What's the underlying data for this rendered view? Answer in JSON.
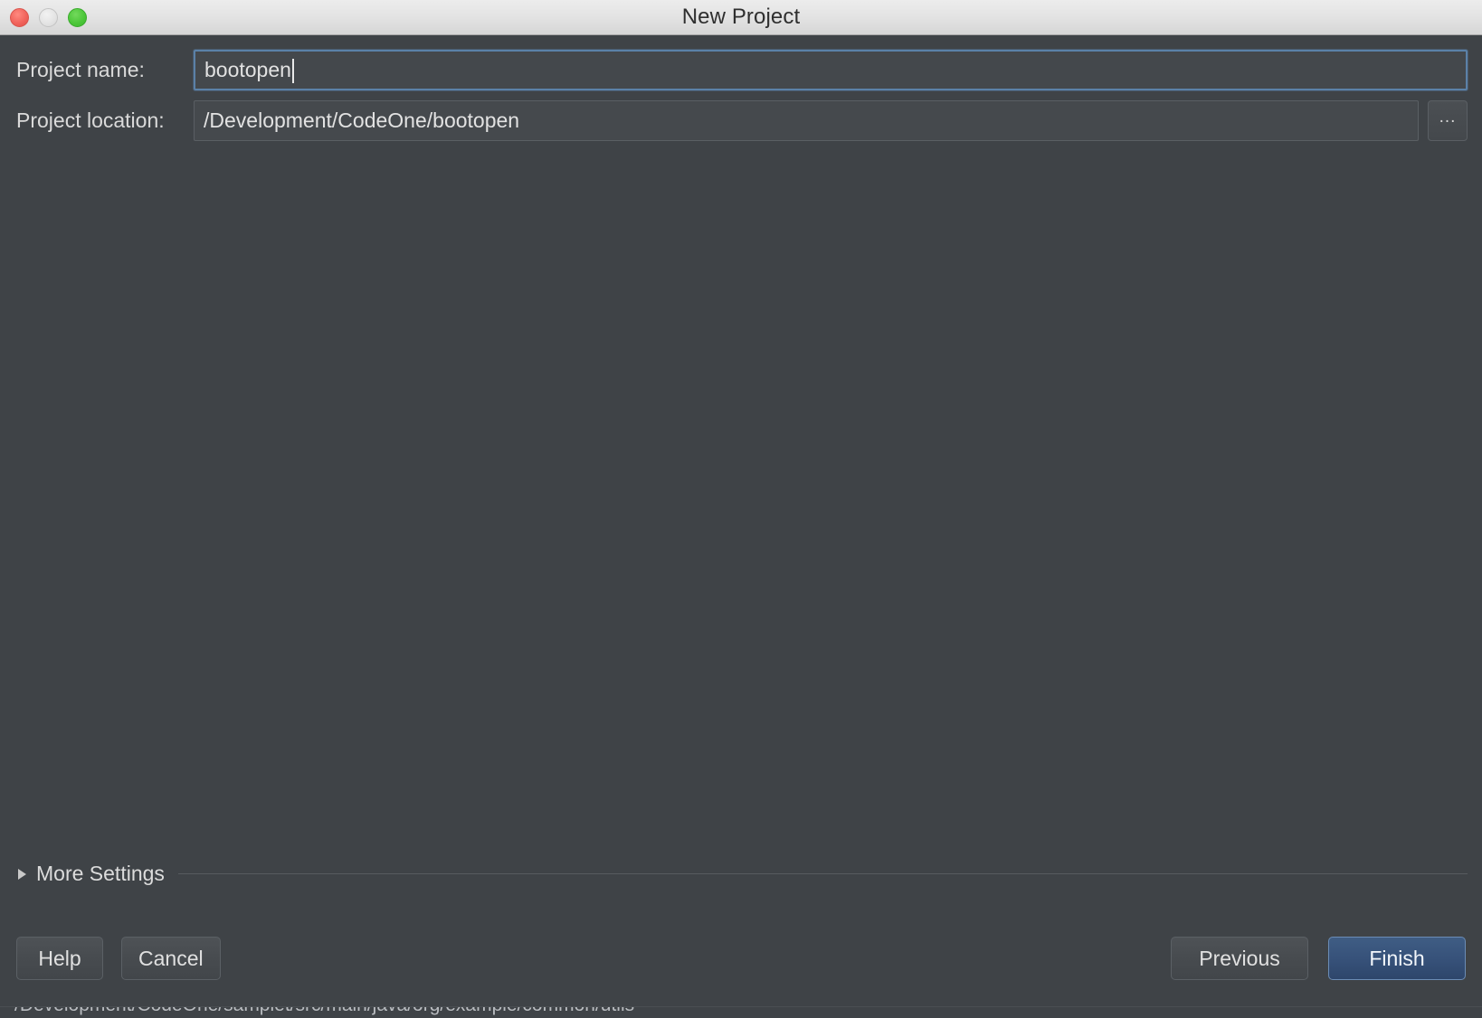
{
  "window": {
    "title": "New Project",
    "traffic_lights": [
      {
        "name": "close",
        "color": "#f1645c"
      },
      {
        "name": "minimize",
        "color": "#e3e3e3"
      },
      {
        "name": "maximize",
        "color": "#4dc73a"
      }
    ],
    "background_color": "#3f4347",
    "titlebar_color": "#e4e4e4"
  },
  "form": {
    "project_name": {
      "label": "Project name:",
      "value": "bootopen",
      "placeholder": "",
      "focused": true
    },
    "project_location": {
      "label": "Project location:",
      "value": "/Development/CodeOne/bootopen",
      "placeholder": "",
      "focused": false,
      "browse_label": "..."
    }
  },
  "more_settings": {
    "label": "More Settings",
    "expanded": false,
    "disclosure_icon": "triangle-right-icon"
  },
  "footer": {
    "help_label": "Help",
    "cancel_label": "Cancel",
    "previous_label": "Previous",
    "finish_label": "Finish",
    "finish_accent_color": "#37527a"
  },
  "bottom_strip": {
    "path_text": "/Development/CodeOne/samplet/src/main/java/org/example/common/utils"
  }
}
